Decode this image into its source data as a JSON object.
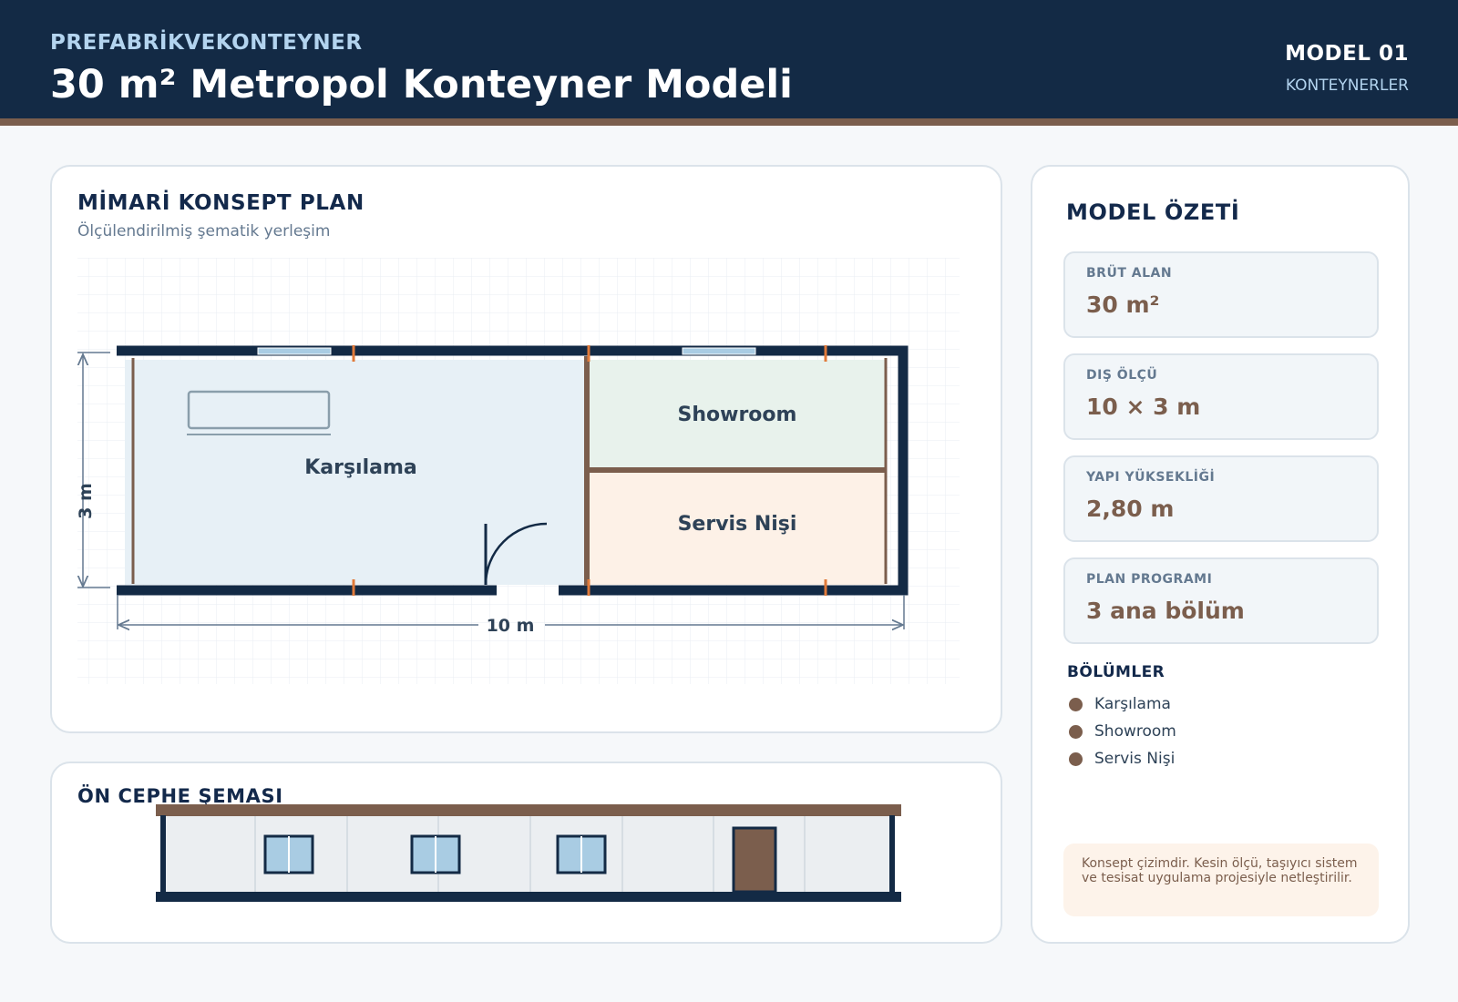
{
  "header": {
    "brand": "PREFABRİKVEKONTEYNER",
    "title": "30 m² Metropol Konteyner Modeli",
    "model_no": "MODEL 01",
    "category": "KONTEYNERLER"
  },
  "plan": {
    "title": "MİMARİ KONSEPT PLAN",
    "subtitle": "Ölçülendirilmiş şematik yerleşim",
    "rooms": {
      "reception": "Karşılama",
      "showroom": "Showroom",
      "service": "Servis Nişi"
    },
    "dims": {
      "width": "10 m",
      "depth": "3 m"
    }
  },
  "front": {
    "title": "ÖN CEPHE ŞEMASI"
  },
  "summary": {
    "title": "MODEL ÖZETİ",
    "stats": [
      {
        "label": "BRÜT ALAN",
        "value": "30 m²"
      },
      {
        "label": "DIŞ ÖLÇÜ",
        "value": "10 × 3 m"
      },
      {
        "label": "YAPI YÜKSEKLİĞİ",
        "value": "2,80 m"
      },
      {
        "label": "PLAN PROGRAMI",
        "value": "3 ana bölüm"
      }
    ],
    "sections_title": "BÖLÜMLER",
    "sections": [
      "Karşılama",
      "Showroom",
      "Servis Nişi"
    ],
    "note": "Konsept çizimdir. Kesin ölçü, taşıyıcı sistem ve tesisat uygulama projesiyle netleştirilir."
  },
  "colors": {
    "navy": "#132a45",
    "brown": "#7b5e4d",
    "accent_light": "#b3d4ef",
    "reception_fill": "#e7f0f6",
    "showroom_fill": "#e8f2ec",
    "service_fill": "#fdf1e7",
    "window": "#a9cce3",
    "orange_mark": "#e07a3a"
  }
}
